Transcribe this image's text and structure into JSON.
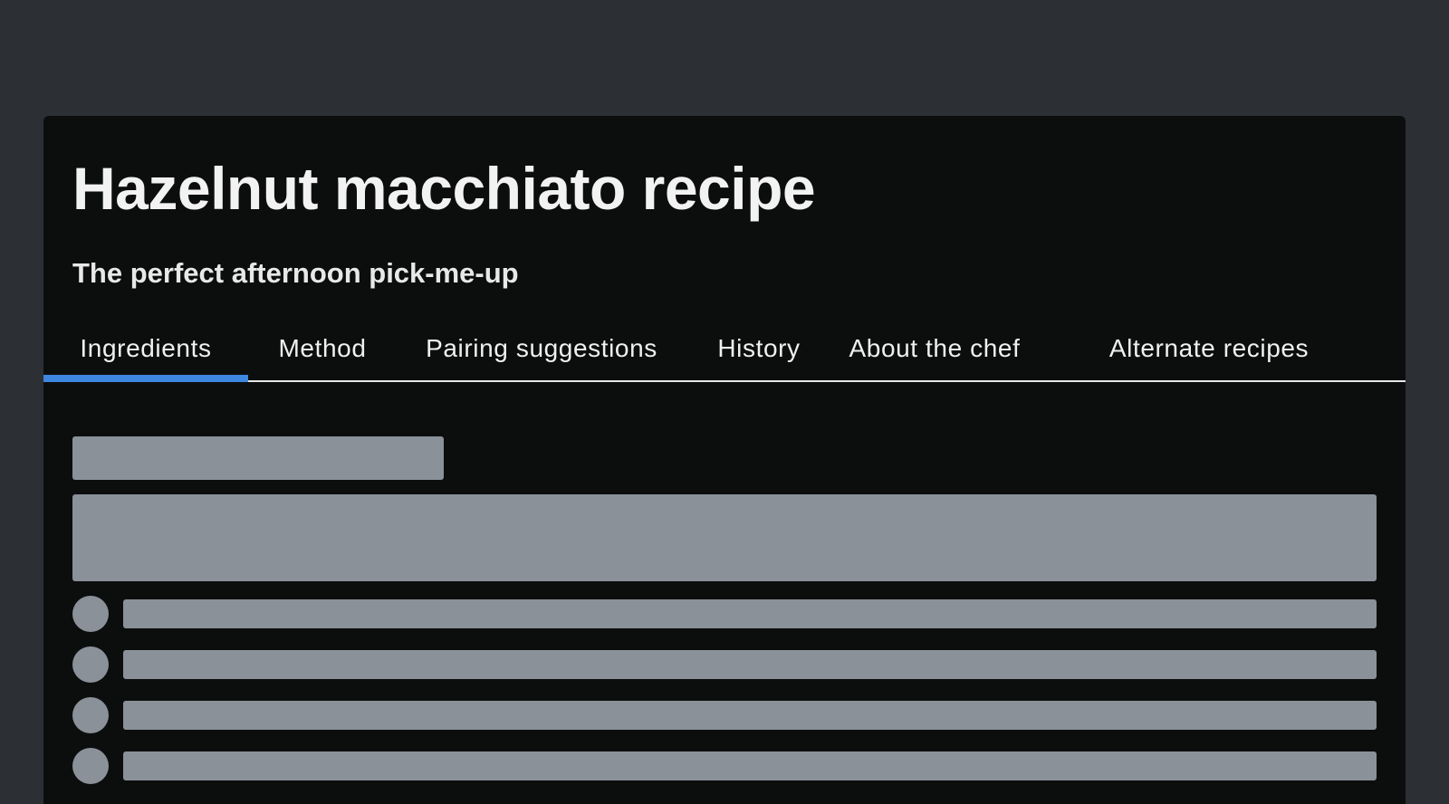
{
  "recipe": {
    "title": "Hazelnut macchiato recipe",
    "subtitle": "The perfect afternoon pick-me-up"
  },
  "tabs": [
    {
      "label": "Ingredients",
      "active": true
    },
    {
      "label": "Method",
      "active": false
    },
    {
      "label": "Pairing suggestions",
      "active": false
    },
    {
      "label": "History",
      "active": false
    },
    {
      "label": "About the chef",
      "active": false
    },
    {
      "label": "Alternate recipes",
      "active": false
    }
  ],
  "content": {
    "state": "loading",
    "skeleton_list_items": 4
  },
  "colors": {
    "background": "#2c2f34",
    "card": "#0c0e0e",
    "active_tab_indicator": "#3f86e0",
    "skeleton": "#8a9199",
    "text": "#f2f2f2"
  }
}
